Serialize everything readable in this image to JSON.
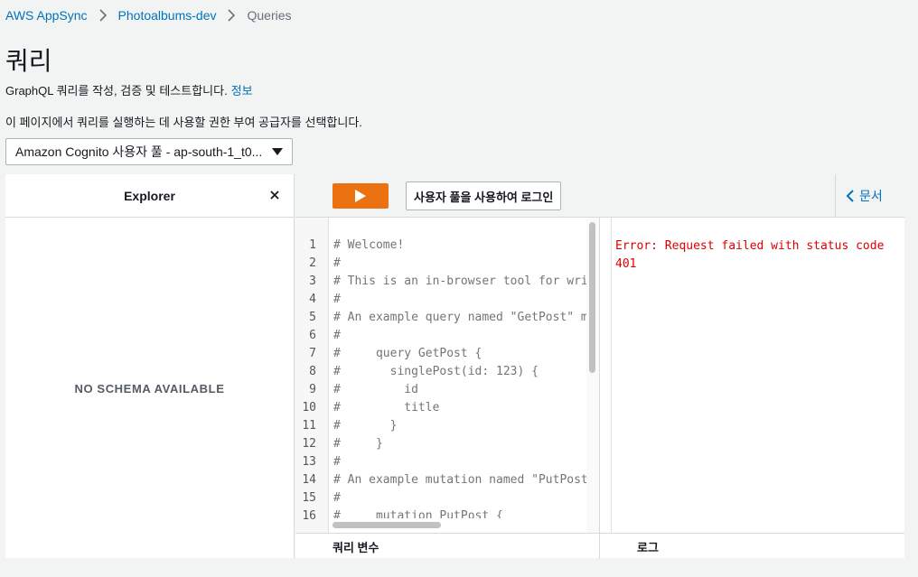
{
  "breadcrumb": {
    "items": [
      "AWS AppSync",
      "Photoalbums-dev"
    ],
    "current": "Queries"
  },
  "page": {
    "title": "쿼리",
    "description": "GraphQL 쿼리를 작성, 검증 및 테스트합니다.",
    "info_link": "정보",
    "auth_description": "이 페이지에서 쿼리를 실행하는 데 사용할 권한 부여 공급자를 선택합니다."
  },
  "auth_select": {
    "value": "Amazon Cognito 사용자 풀 - ap-south-1_t0..."
  },
  "explorer": {
    "title": "Explorer",
    "empty_text": "NO SCHEMA AVAILABLE"
  },
  "toolbar": {
    "login_label": "사용자 풀을 사용하여 로그인",
    "docs_label": "문서"
  },
  "editor": {
    "line_numbers": [
      "1",
      "2",
      "3",
      "4",
      "5",
      "6",
      "7",
      "8",
      "9",
      "10",
      "11",
      "12",
      "13",
      "14",
      "15",
      "16"
    ],
    "lines": [
      "# Welcome!",
      "#",
      "# This is an in-browser tool for writing",
      "#",
      "# An example query named \"GetPost\" might look like:",
      "#",
      "#     query GetPost {",
      "#       singlePost(id: 123) {",
      "#         id",
      "#         title",
      "#       }",
      "#     }",
      "#",
      "# An example mutation named \"PutPost\" might look like:",
      "#",
      "#     mutation PutPost {"
    ]
  },
  "result": {
    "error": "Error: Request failed with status code 401"
  },
  "bottom": {
    "query_variables": "쿼리 변수",
    "logs": "로그"
  }
}
